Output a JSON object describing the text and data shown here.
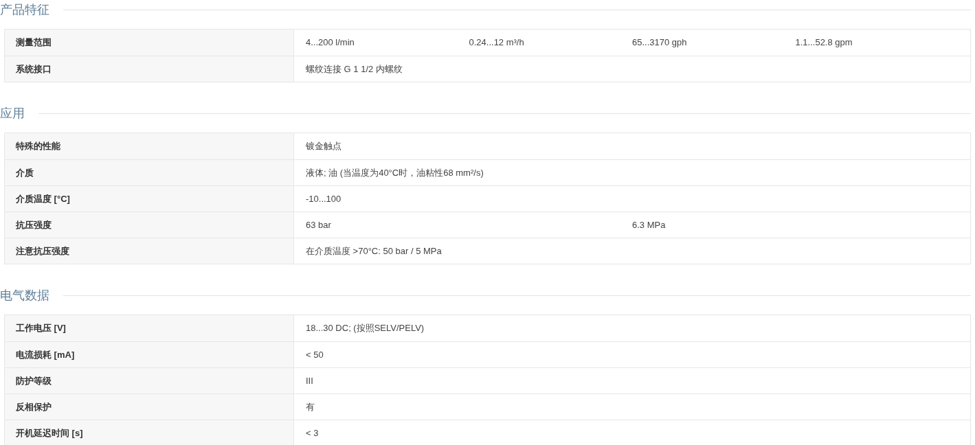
{
  "sections": [
    {
      "title": "产品特征",
      "rows": [
        {
          "label": "测量范围",
          "column_1": "4...200 l/min",
          "column_2": "0.24...12 m³/h",
          "column_3": "65...3170 gph",
          "column_4": "1.1...52.8 gpm"
        },
        {
          "label": "系统接口",
          "column_1": "螺纹连接 G 1 1/2 内螺纹"
        }
      ]
    },
    {
      "title": "应用",
      "rows": [
        {
          "label": "特殊的性能",
          "column_1": "镀金触点"
        },
        {
          "label": "介质",
          "column_1": "液体; 油 (当温度为40°C时，油粘性68 mm²/s)"
        },
        {
          "label": "介质温度 [°C]",
          "column_1": "-10...100"
        },
        {
          "label": "抗压强度",
          "column_1": "63 bar",
          "column_3": "6.3 MPa"
        },
        {
          "label": "注意抗压强度",
          "column_1": "在介质温度 >70°C: 50 bar / 5 MPa"
        }
      ]
    },
    {
      "title": "电气数据",
      "rows": [
        {
          "label": "工作电压 [V]",
          "column_1": "18...30 DC; (按照SELV/PELV)"
        },
        {
          "label": "电流损耗 [mA]",
          "column_1": "< 50"
        },
        {
          "label": "防护等级",
          "column_1": "III"
        },
        {
          "label": "反相保护",
          "column_1": "有"
        },
        {
          "label": "开机延迟时间 [s]",
          "column_1": "< 3"
        }
      ]
    }
  ]
}
